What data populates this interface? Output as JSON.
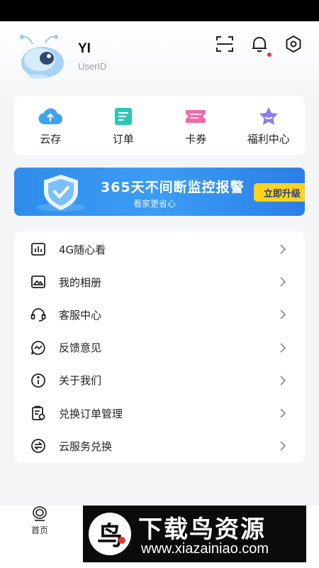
{
  "profile": {
    "name": "YI",
    "user_id": "UserID"
  },
  "header_icons": [
    "scan-icon",
    "bell-icon",
    "settings-icon"
  ],
  "notification": {
    "has_unread": true,
    "color": "#e53935"
  },
  "quick_actions": [
    {
      "label": "云存",
      "icon": "cloud-upload-icon",
      "color": "#3fa3f0"
    },
    {
      "label": "订单",
      "icon": "order-icon",
      "color": "#2cc7b0"
    },
    {
      "label": "卡券",
      "icon": "coupon-icon",
      "color": "#f06aa8"
    },
    {
      "label": "福利中心",
      "icon": "star-badge-icon",
      "color": "#8a7cf0"
    }
  ],
  "banner": {
    "title": "365天不间断监控报警",
    "subtitle": "看家更省心",
    "button": "立即升级",
    "accent": "#2f8dea",
    "button_color": "#ffd21e"
  },
  "menu": [
    {
      "label": "4G随心看",
      "icon": "sim-card-icon"
    },
    {
      "label": "我的相册",
      "icon": "photo-album-icon"
    },
    {
      "label": "客服中心",
      "icon": "headset-icon"
    },
    {
      "label": "反馈意见",
      "icon": "feedback-icon"
    },
    {
      "label": "关于我们",
      "icon": "info-icon"
    },
    {
      "label": "兑换订单管理",
      "icon": "clipboard-icon"
    },
    {
      "label": "云服务兑换",
      "icon": "exchange-icon"
    }
  ],
  "tabbar": {
    "home_label": "首页",
    "home_icon": "camera-home-icon"
  },
  "watermark": {
    "title": "下载鸟资源",
    "url": "www.xiazainiao.com"
  }
}
